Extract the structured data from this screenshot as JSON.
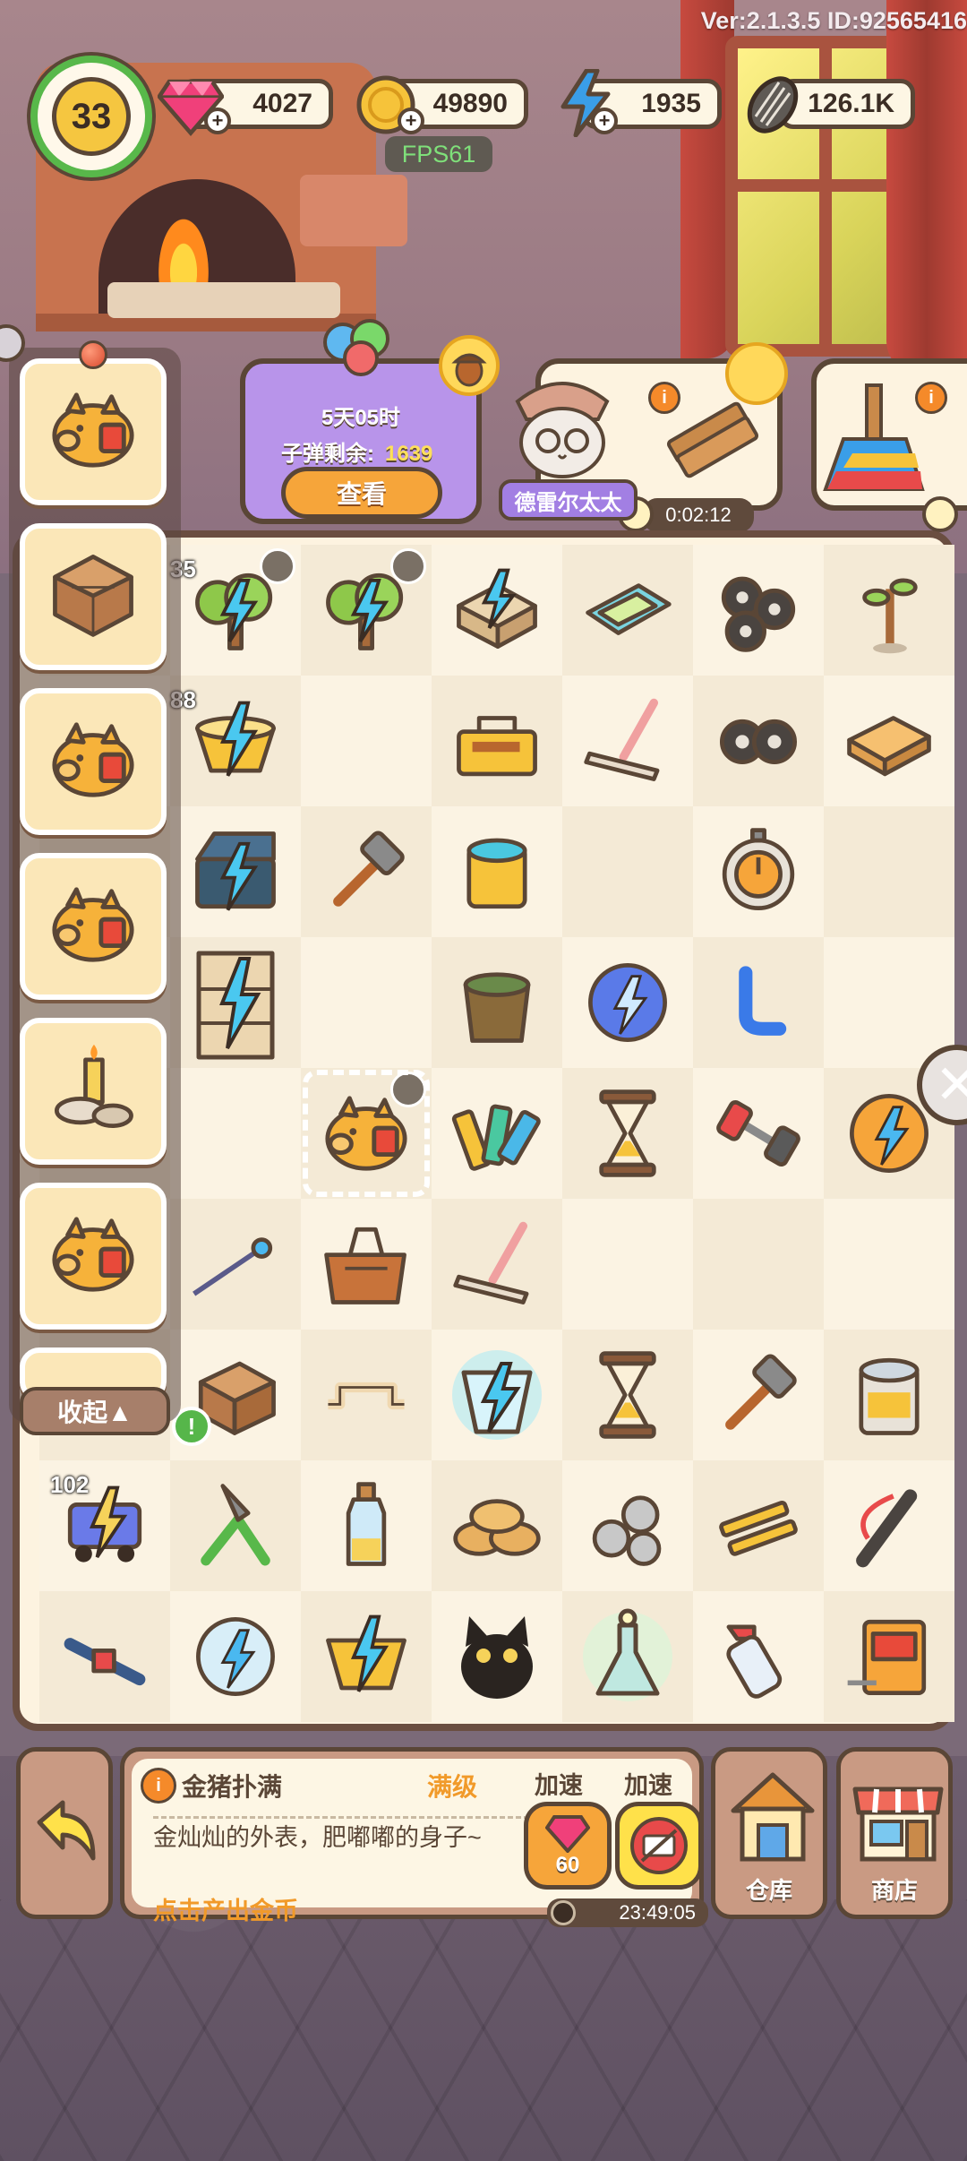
{
  "version_text": "Ver:2.1.3.5 ID:92565416",
  "fps_text": "FPS61",
  "player": {
    "level": "33"
  },
  "resources": [
    {
      "icon": "gem-icon",
      "value": "4027"
    },
    {
      "icon": "coin-icon",
      "value": "49890"
    },
    {
      "icon": "energy-icon",
      "value": "1935"
    },
    {
      "icon": "seed-icon",
      "value": "126.1K"
    }
  ],
  "event": {
    "time_left": "5天05时",
    "bullets_label": "子弹剩余:",
    "bullets_value": "1639",
    "view_button": "查看"
  },
  "orders": {
    "npc_name": "德雷尔太太",
    "timer": "0:02:12"
  },
  "queue": {
    "items": [
      "piggy-bank-icon",
      "crystal-cube-icon",
      "piggy-bank-icon",
      "piggy-bank-icon",
      "candle-set-icon",
      "piggy-bank-icon"
    ],
    "collapse_label": "收起▲"
  },
  "board": {
    "badge_35": "35",
    "badge_88": "88",
    "badge_102": "102"
  },
  "info_panel": {
    "title": "金猪扑满",
    "level": "满级",
    "description": "金灿灿的外表，肥嘟嘟的身子~",
    "action": "点击产出金币",
    "speed_label_1": "加速",
    "speed_label_2": "加速",
    "gem_cost": "60",
    "timer": "23:49:05"
  },
  "nav": {
    "warehouse": "仓库",
    "shop": "商店"
  },
  "colors": {
    "board_bg": "#fdf3e0",
    "frame": "#6a4e40",
    "accent_orange": "#f19a2a",
    "event_purple": "#b894ea"
  }
}
